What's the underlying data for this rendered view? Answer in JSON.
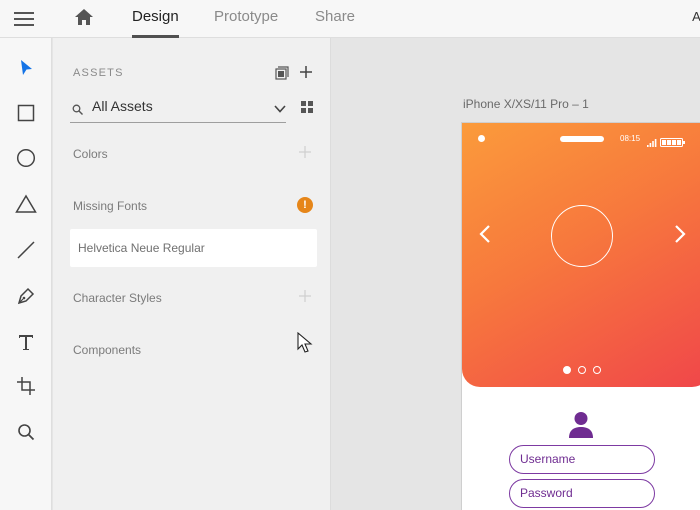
{
  "header": {
    "tabs": [
      {
        "label": "Design",
        "active": true
      },
      {
        "label": "Prototype",
        "active": false
      },
      {
        "label": "Share",
        "active": false
      }
    ],
    "app_label_partial": "Ap"
  },
  "toolbar": {
    "tools": [
      "select-tool",
      "rectangle-tool",
      "ellipse-tool",
      "polygon-tool",
      "line-tool",
      "pen-tool",
      "text-tool",
      "artboard-tool",
      "zoom-tool"
    ],
    "active_tool": "select-tool",
    "accent_color": "#1473e6"
  },
  "assets": {
    "title": "ASSETS",
    "filter_value": "All Assets",
    "sections": {
      "colors": "Colors",
      "missing_fonts": "Missing Fonts",
      "character_styles": "Character Styles",
      "components": "Components"
    },
    "missing_font_name": "Helvetica Neue Regular",
    "warning_glyph": "!",
    "warning_color": "#e68619"
  },
  "canvas": {
    "artboard_name": "iPhone X/XS/11 Pro – 1",
    "status_time": "08:15",
    "carousel_dots": 3,
    "carousel_active": 0,
    "username_placeholder": "Username",
    "password_placeholder": "Password",
    "field_color": "#7d3aa2"
  }
}
